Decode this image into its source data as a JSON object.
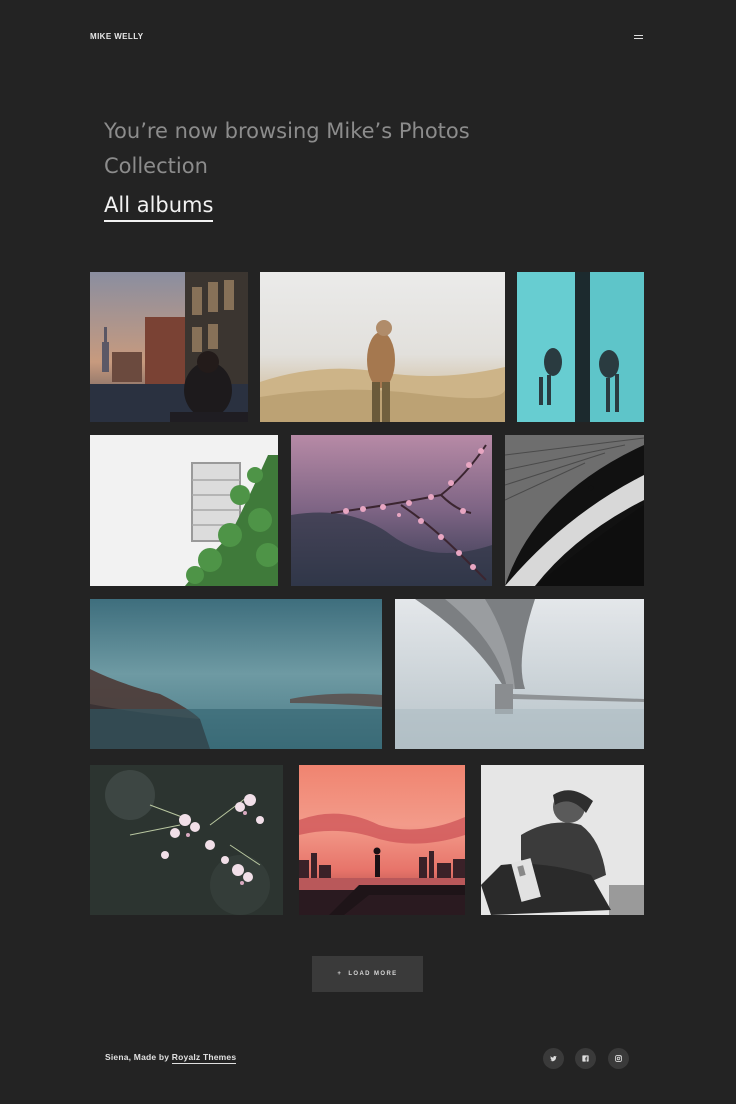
{
  "header": {
    "brand": "MIKE WELLY",
    "menu_icon": "hamburger-menu-icon"
  },
  "hero": {
    "text": "You’re now browsing Mike’s Photos Collection",
    "link_label": "All albums"
  },
  "gallery": {
    "photos": [
      {
        "subject": "woman looking at city skyline with hotel building"
      },
      {
        "subject": "person standing in dry grass field"
      },
      {
        "subject": "swimmers seen through turquoise glass"
      },
      {
        "subject": "window with green ivy on white wall"
      },
      {
        "subject": "pink blossom branch"
      },
      {
        "subject": "lone person on curved architecture staircase"
      },
      {
        "subject": "misty teal coastline"
      },
      {
        "subject": "concrete bridge over calm water"
      },
      {
        "subject": "white and pink flowers close-up"
      },
      {
        "subject": "silhouette at pink sunset over city"
      },
      {
        "subject": "black and white portrait of man crouching"
      }
    ]
  },
  "load_more": {
    "icon": "plus-icon",
    "label": "LOAD MORE"
  },
  "footer": {
    "credit_prefix": "Siena, Made by",
    "credit_link": "Royalz Themes",
    "social": [
      "twitter-icon",
      "facebook-icon",
      "instagram-icon"
    ]
  },
  "colors": {
    "background": "#232323",
    "button": "#3a3a3a",
    "hero_text": "#8c8c8c"
  }
}
